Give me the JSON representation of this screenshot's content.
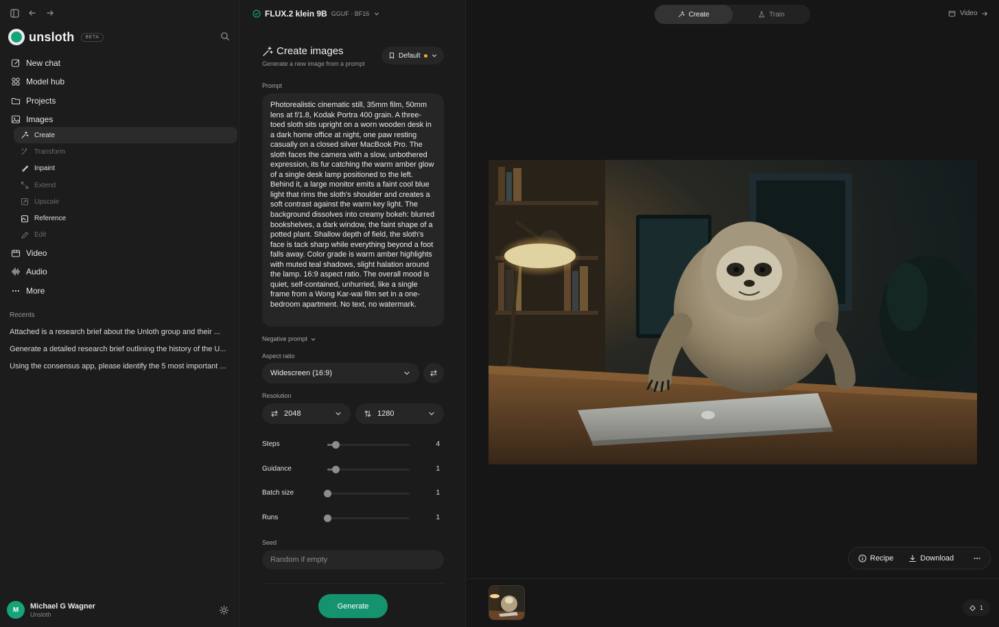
{
  "sidebar": {
    "brand": "unsloth",
    "badge": "BETA",
    "nav": [
      {
        "label": "New chat",
        "icon": "edit-icon"
      },
      {
        "label": "Model hub",
        "icon": "grid-icon"
      },
      {
        "label": "Projects",
        "icon": "folder-icon"
      },
      {
        "label": "Images",
        "icon": "image-icon"
      }
    ],
    "images_sub": [
      {
        "label": "Create",
        "state": "active",
        "icon": "sparkle-icon"
      },
      {
        "label": "Transform",
        "state": "disabled",
        "icon": "wand-icon"
      },
      {
        "label": "Inpaint",
        "state": "enabled",
        "icon": "brush-icon"
      },
      {
        "label": "Extend",
        "state": "disabled",
        "icon": "expand-icon"
      },
      {
        "label": "Upscale",
        "state": "disabled",
        "icon": "upscale-icon"
      },
      {
        "label": "Reference",
        "state": "enabled",
        "icon": "reference-icon"
      },
      {
        "label": "Edit",
        "state": "disabled",
        "icon": "pencil-icon"
      }
    ],
    "nav2": [
      {
        "label": "Video",
        "icon": "video-icon"
      },
      {
        "label": "Audio",
        "icon": "waveform-icon"
      },
      {
        "label": "More",
        "icon": "more-icon"
      }
    ],
    "recents_title": "Recents",
    "recents": [
      "Attached is a research brief about the Unloth group and their ...",
      "Generate a detailed research brief outlining the history of the U...",
      "Using the consensus app, please identify the 5 most important ..."
    ],
    "user": {
      "initial": "M",
      "name": "Michael G Wagner",
      "org": "Unsloth"
    }
  },
  "panel": {
    "model_name": "FLUX.2 klein 9B",
    "model_meta": "GGUF · BF16",
    "title": "Create images",
    "subtitle": "Generate a new image from a prompt",
    "preset": "Default",
    "prompt_label": "Prompt",
    "prompt": "Photorealistic cinematic still, 35mm film, 50mm lens at f/1.8, Kodak Portra 400 grain. A three-toed sloth sits upright on a worn wooden desk in a dark home office at night, one paw resting casually on a closed silver MacBook Pro. The sloth faces the camera with a slow, unbothered expression, its fur catching the warm amber glow of a single desk lamp positioned to the left. Behind it, a large monitor emits a faint cool blue light that rims the sloth's shoulder and creates a soft contrast against the warm key light. The background dissolves into creamy bokeh: blurred bookshelves, a dark window, the faint shape of a potted plant. Shallow depth of field, the sloth's face is tack sharp while everything beyond a foot falls away. Color grade is warm amber highlights with muted teal shadows, slight halation around the lamp. 16:9 aspect ratio. The overall mood is quiet, self-contained, unhurried, like a single frame from a Wong Kar-wai film set in a one-bedroom apartment. No text, no watermark.",
    "negative_label": "Negative prompt",
    "aspect_label": "Aspect ratio",
    "aspect_value": "Widescreen (16:9)",
    "resolution_label": "Resolution",
    "width": "2048",
    "height": "1280",
    "sliders": [
      {
        "label": "Steps",
        "value": "4",
        "fraction": 0.1
      },
      {
        "label": "Guidance",
        "value": "1",
        "fraction": 0.1
      },
      {
        "label": "Batch size",
        "value": "1",
        "fraction": 0.0
      },
      {
        "label": "Runs",
        "value": "1",
        "fraction": 0.0
      }
    ],
    "seed_label": "Seed",
    "seed_placeholder": "Random if empty",
    "generate": "Generate"
  },
  "main": {
    "tab_create": "Create",
    "tab_train": "Train",
    "video_link": "Video",
    "recipe": "Recipe",
    "download": "Download",
    "count": "1"
  },
  "colors": {
    "accent": "#15936e",
    "preset_dot": "#f2b21b"
  }
}
